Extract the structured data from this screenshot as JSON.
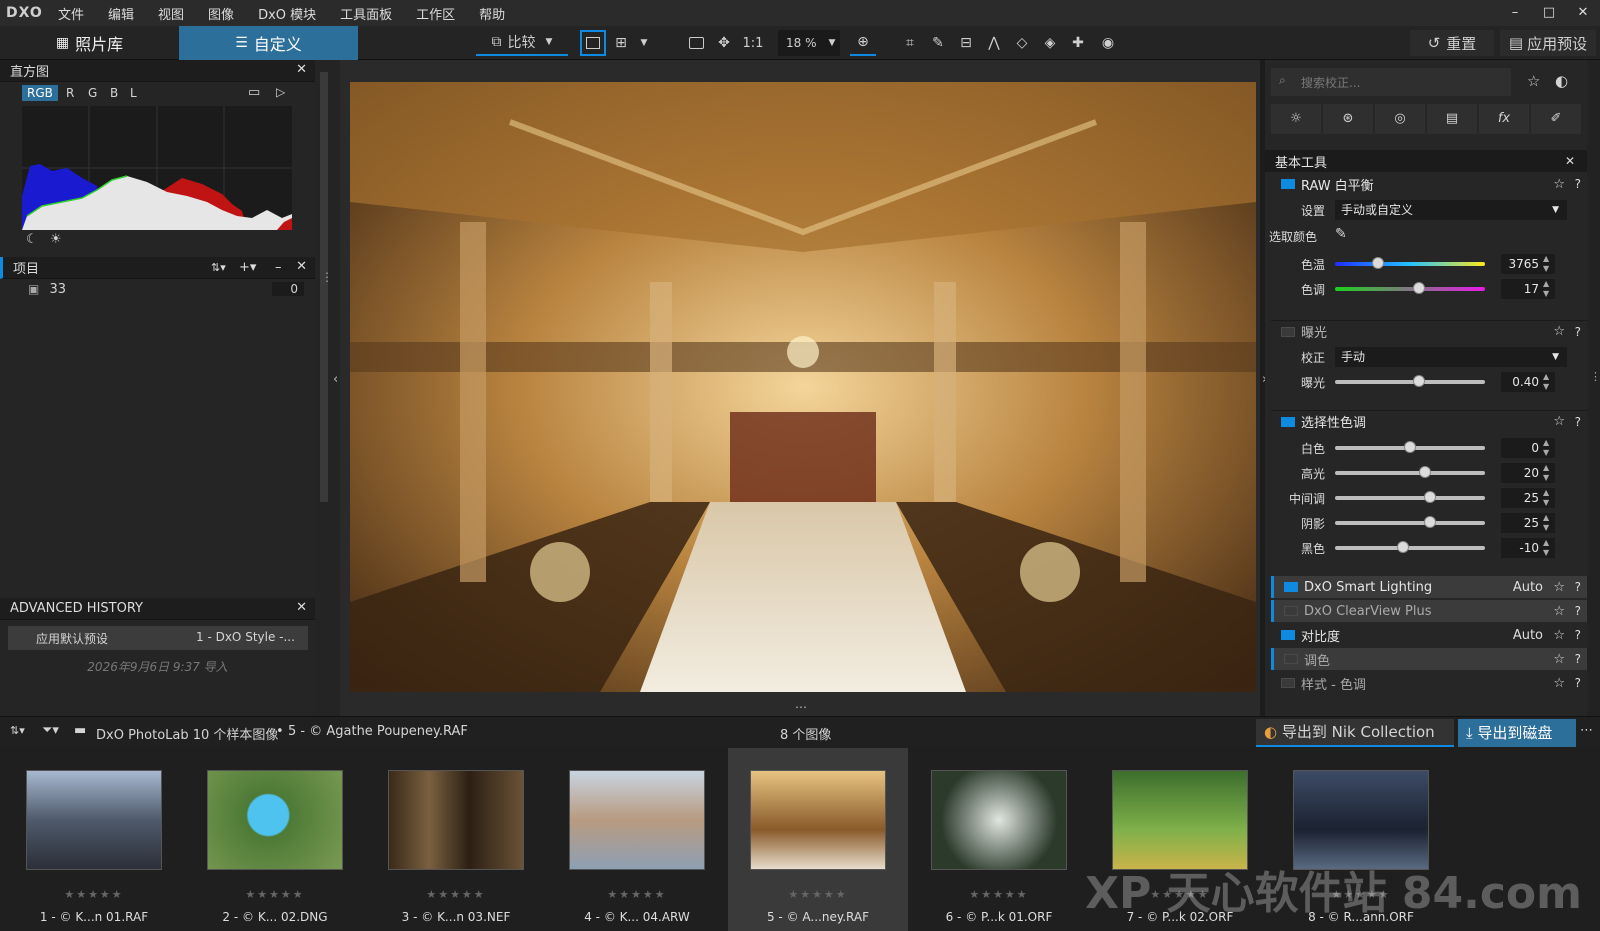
{
  "app": {
    "logo": "DXO"
  },
  "menu": [
    "文件",
    "编辑",
    "视图",
    "图像",
    "DxO 模块",
    "工具面板",
    "工作区",
    "帮助"
  ],
  "window_controls": [
    "–",
    "□",
    "✕"
  ],
  "tabs": {
    "library": "照片库",
    "customize": "自定义"
  },
  "toolbar": {
    "compare": "比较",
    "one_to_one": "1:1",
    "zoom": "18 %",
    "reset": "重置",
    "apply_preset": "应用预设"
  },
  "histogram": {
    "title": "直方图",
    "channels": [
      "RGB",
      "R",
      "G",
      "B",
      "L"
    ],
    "active_channel": "RGB"
  },
  "projects": {
    "title": "项目",
    "items": [
      {
        "label": "33",
        "count": "0"
      }
    ]
  },
  "history": {
    "title": "ADVANCED HISTORY",
    "items": [
      {
        "action": "应用默认预设",
        "detail": "1 - DxO Style -..."
      }
    ],
    "import_note": "2026年9月6日 9:37 导入"
  },
  "right_panel": {
    "search_placeholder": "搜索校正...",
    "basic_tools": "基本工具",
    "raw_wb": {
      "title": "RAW 白平衡",
      "setting_label": "设置",
      "setting_value": "手动或自定义",
      "pick_label": "选取颜色",
      "temp_label": "色温",
      "temp_value": "3765",
      "tint_label": "色调",
      "tint_value": "17"
    },
    "exposure": {
      "title": "曝光",
      "mode_label": "校正",
      "mode_value": "手动",
      "exp_label": "曝光",
      "exp_value": "0.40"
    },
    "selective_tone": {
      "title": "选择性色调",
      "sliders": [
        {
          "label": "白色",
          "value": "0",
          "pos": 0.5
        },
        {
          "label": "高光",
          "value": "20",
          "pos": 0.6
        },
        {
          "label": "中间调",
          "value": "25",
          "pos": 0.63
        },
        {
          "label": "阴影",
          "value": "25",
          "pos": 0.63
        },
        {
          "label": "黑色",
          "value": "-10",
          "pos": 0.45
        }
      ]
    },
    "smart_lighting": {
      "title": "DxO Smart Lighting",
      "mode": "Auto"
    },
    "clearview": {
      "title": "DxO ClearView Plus"
    },
    "contrast": {
      "title": "对比度",
      "mode": "Auto"
    },
    "toning": {
      "title": "调色"
    },
    "style_tone": {
      "title": "样式 - 色调"
    }
  },
  "bottom": {
    "breadcrumb_root": "DxO PhotoLab 10 个样本图像",
    "breadcrumb_file": "5 - © Agathe Poupeney.RAF",
    "count": "8 个图像",
    "nik": "导出到 Nik Collection",
    "export": "导出到磁盘"
  },
  "thumbnails": [
    {
      "name": "1 - © K...n 01.RAF"
    },
    {
      "name": "2 - © K... 02.DNG"
    },
    {
      "name": "3 - © K...n 03.NEF"
    },
    {
      "name": "4 - © K... 04.ARW"
    },
    {
      "name": "5 - © A...ney.RAF"
    },
    {
      "name": "6 - © P...k 01.ORF"
    },
    {
      "name": "7 - © P...k 02.ORF"
    },
    {
      "name": "8 - © R...ann.ORF"
    }
  ],
  "watermark": "XP 天心软件站 84.com",
  "colors": {
    "accent": "#2c6f9a",
    "check_on": "#0e8ae0"
  }
}
